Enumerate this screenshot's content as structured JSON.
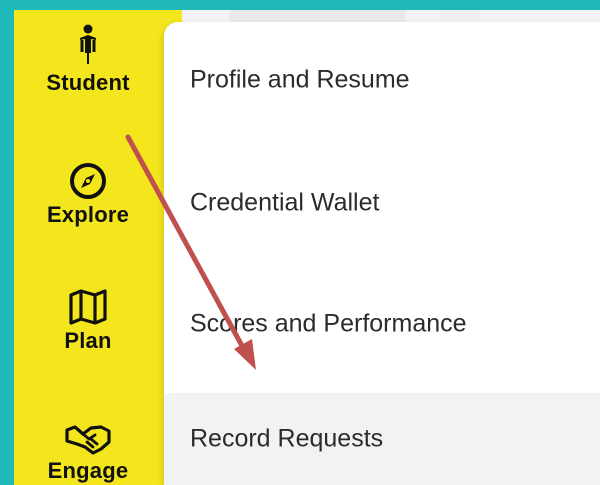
{
  "sidebar": {
    "items": [
      {
        "label": "Student",
        "icon": "person-icon"
      },
      {
        "label": "Explore",
        "icon": "compass-icon"
      },
      {
        "label": "Plan",
        "icon": "map-icon"
      },
      {
        "label": "Engage",
        "icon": "handshake-icon"
      }
    ]
  },
  "menu": {
    "items": [
      {
        "label": "Profile and Resume"
      },
      {
        "label": "Credential Wallet"
      },
      {
        "label": "Scores and Performance"
      },
      {
        "label": "Record Requests",
        "highlighted": true
      }
    ]
  },
  "colors": {
    "sidebar_bg": "#f4e61d",
    "outer_border": "#1fb9b9",
    "annotation_arrow": "#c0504d",
    "highlight_bg": "#f2f2f2"
  }
}
